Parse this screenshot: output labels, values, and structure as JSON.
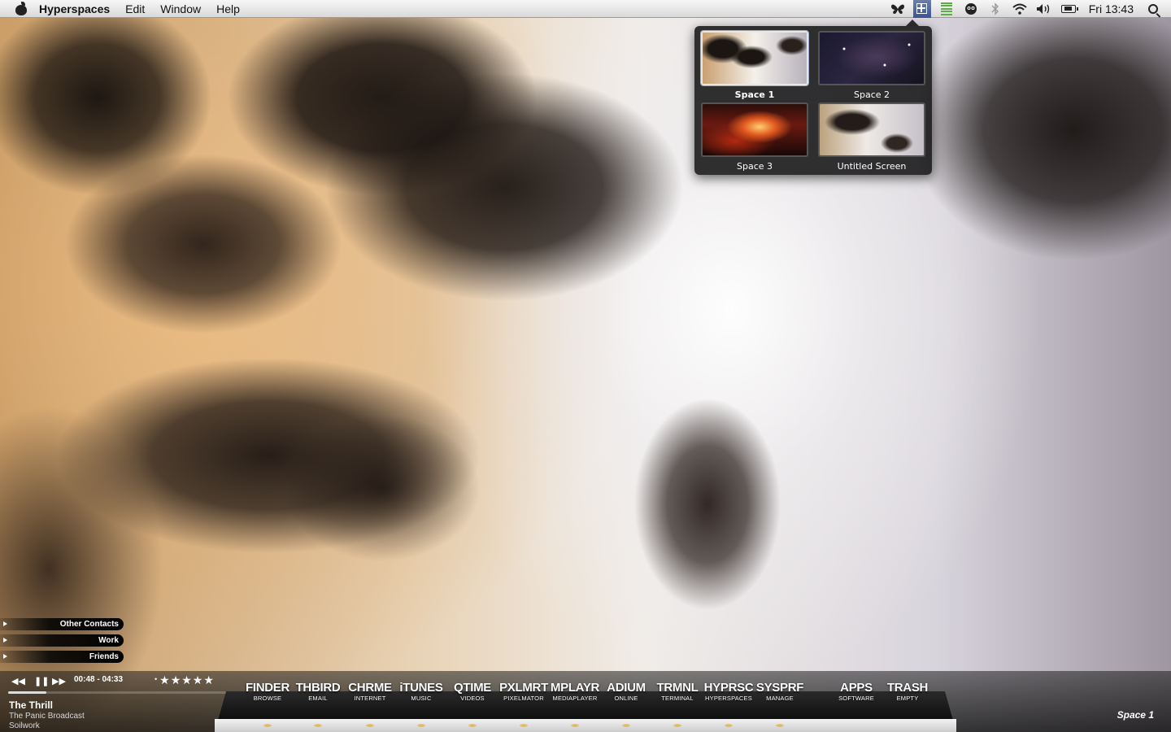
{
  "menubar": {
    "app_name": "Hyperspaces",
    "items": [
      "Edit",
      "Window",
      "Help"
    ],
    "clock": "Fri 13:43",
    "status_icons": [
      "butterfly-icon",
      "spaces-icon",
      "activity-bars-icon",
      "creature-icon",
      "bluetooth-icon",
      "wifi-icon",
      "volume-icon",
      "battery-icon"
    ]
  },
  "spaces": [
    {
      "label": "Space 1",
      "selected": true
    },
    {
      "label": "Space 2",
      "selected": false
    },
    {
      "label": "Space 3",
      "selected": false
    },
    {
      "label": "Untitled Screen",
      "selected": false
    }
  ],
  "contacts": [
    "Other Contacts",
    "Work",
    "Friends"
  ],
  "player": {
    "time": "00:48 - 04:33",
    "progress": 0.176,
    "rating_stars": "★★★★★",
    "rating_dot": "•",
    "title": "The Thrill",
    "album": "The Panic Broadcast",
    "artist": "Soilwork"
  },
  "dock": [
    {
      "name": "FINDER",
      "sub": "BROWSE"
    },
    {
      "name": "THBIRD",
      "sub": "EMAIL"
    },
    {
      "name": "CHRME",
      "sub": "INTERNET"
    },
    {
      "name": "iTUNES",
      "sub": "MUSIC"
    },
    {
      "name": "QTIME",
      "sub": "VIDEOS"
    },
    {
      "name": "PXLMRT",
      "sub": "PIXELMATOR"
    },
    {
      "name": "MPLAYR",
      "sub": "MEDIAPLAYER"
    },
    {
      "name": "ADIUM",
      "sub": "ONLINE"
    },
    {
      "name": "TRMNL",
      "sub": "TERMINAL"
    },
    {
      "name": "HYPRSC",
      "sub": "HYPERSPACES"
    },
    {
      "name": "SYSPRF",
      "sub": "MANAGE"
    },
    {
      "name": "APPS",
      "sub": "SOFTWARE"
    },
    {
      "name": "TRASH",
      "sub": "EMPTY"
    }
  ],
  "space_indicator": "Space 1",
  "colors": {
    "accent": "#3c5490",
    "dock_indicator": "#e8b040"
  }
}
